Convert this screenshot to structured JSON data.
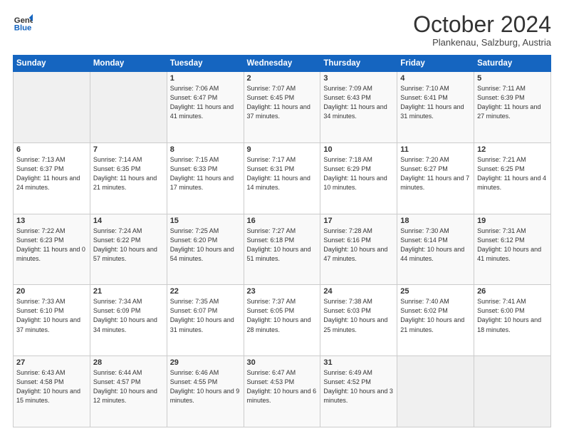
{
  "header": {
    "logo_line1": "General",
    "logo_line2": "Blue",
    "month_title": "October 2024",
    "subtitle": "Plankenau, Salzburg, Austria"
  },
  "days_of_week": [
    "Sunday",
    "Monday",
    "Tuesday",
    "Wednesday",
    "Thursday",
    "Friday",
    "Saturday"
  ],
  "weeks": [
    [
      {
        "day": "",
        "sunrise": "",
        "sunset": "",
        "daylight": ""
      },
      {
        "day": "",
        "sunrise": "",
        "sunset": "",
        "daylight": ""
      },
      {
        "day": "1",
        "sunrise": "Sunrise: 7:06 AM",
        "sunset": "Sunset: 6:47 PM",
        "daylight": "Daylight: 11 hours and 41 minutes."
      },
      {
        "day": "2",
        "sunrise": "Sunrise: 7:07 AM",
        "sunset": "Sunset: 6:45 PM",
        "daylight": "Daylight: 11 hours and 37 minutes."
      },
      {
        "day": "3",
        "sunrise": "Sunrise: 7:09 AM",
        "sunset": "Sunset: 6:43 PM",
        "daylight": "Daylight: 11 hours and 34 minutes."
      },
      {
        "day": "4",
        "sunrise": "Sunrise: 7:10 AM",
        "sunset": "Sunset: 6:41 PM",
        "daylight": "Daylight: 11 hours and 31 minutes."
      },
      {
        "day": "5",
        "sunrise": "Sunrise: 7:11 AM",
        "sunset": "Sunset: 6:39 PM",
        "daylight": "Daylight: 11 hours and 27 minutes."
      }
    ],
    [
      {
        "day": "6",
        "sunrise": "Sunrise: 7:13 AM",
        "sunset": "Sunset: 6:37 PM",
        "daylight": "Daylight: 11 hours and 24 minutes."
      },
      {
        "day": "7",
        "sunrise": "Sunrise: 7:14 AM",
        "sunset": "Sunset: 6:35 PM",
        "daylight": "Daylight: 11 hours and 21 minutes."
      },
      {
        "day": "8",
        "sunrise": "Sunrise: 7:15 AM",
        "sunset": "Sunset: 6:33 PM",
        "daylight": "Daylight: 11 hours and 17 minutes."
      },
      {
        "day": "9",
        "sunrise": "Sunrise: 7:17 AM",
        "sunset": "Sunset: 6:31 PM",
        "daylight": "Daylight: 11 hours and 14 minutes."
      },
      {
        "day": "10",
        "sunrise": "Sunrise: 7:18 AM",
        "sunset": "Sunset: 6:29 PM",
        "daylight": "Daylight: 11 hours and 10 minutes."
      },
      {
        "day": "11",
        "sunrise": "Sunrise: 7:20 AM",
        "sunset": "Sunset: 6:27 PM",
        "daylight": "Daylight: 11 hours and 7 minutes."
      },
      {
        "day": "12",
        "sunrise": "Sunrise: 7:21 AM",
        "sunset": "Sunset: 6:25 PM",
        "daylight": "Daylight: 11 hours and 4 minutes."
      }
    ],
    [
      {
        "day": "13",
        "sunrise": "Sunrise: 7:22 AM",
        "sunset": "Sunset: 6:23 PM",
        "daylight": "Daylight: 11 hours and 0 minutes."
      },
      {
        "day": "14",
        "sunrise": "Sunrise: 7:24 AM",
        "sunset": "Sunset: 6:22 PM",
        "daylight": "Daylight: 10 hours and 57 minutes."
      },
      {
        "day": "15",
        "sunrise": "Sunrise: 7:25 AM",
        "sunset": "Sunset: 6:20 PM",
        "daylight": "Daylight: 10 hours and 54 minutes."
      },
      {
        "day": "16",
        "sunrise": "Sunrise: 7:27 AM",
        "sunset": "Sunset: 6:18 PM",
        "daylight": "Daylight: 10 hours and 51 minutes."
      },
      {
        "day": "17",
        "sunrise": "Sunrise: 7:28 AM",
        "sunset": "Sunset: 6:16 PM",
        "daylight": "Daylight: 10 hours and 47 minutes."
      },
      {
        "day": "18",
        "sunrise": "Sunrise: 7:30 AM",
        "sunset": "Sunset: 6:14 PM",
        "daylight": "Daylight: 10 hours and 44 minutes."
      },
      {
        "day": "19",
        "sunrise": "Sunrise: 7:31 AM",
        "sunset": "Sunset: 6:12 PM",
        "daylight": "Daylight: 10 hours and 41 minutes."
      }
    ],
    [
      {
        "day": "20",
        "sunrise": "Sunrise: 7:33 AM",
        "sunset": "Sunset: 6:10 PM",
        "daylight": "Daylight: 10 hours and 37 minutes."
      },
      {
        "day": "21",
        "sunrise": "Sunrise: 7:34 AM",
        "sunset": "Sunset: 6:09 PM",
        "daylight": "Daylight: 10 hours and 34 minutes."
      },
      {
        "day": "22",
        "sunrise": "Sunrise: 7:35 AM",
        "sunset": "Sunset: 6:07 PM",
        "daylight": "Daylight: 10 hours and 31 minutes."
      },
      {
        "day": "23",
        "sunrise": "Sunrise: 7:37 AM",
        "sunset": "Sunset: 6:05 PM",
        "daylight": "Daylight: 10 hours and 28 minutes."
      },
      {
        "day": "24",
        "sunrise": "Sunrise: 7:38 AM",
        "sunset": "Sunset: 6:03 PM",
        "daylight": "Daylight: 10 hours and 25 minutes."
      },
      {
        "day": "25",
        "sunrise": "Sunrise: 7:40 AM",
        "sunset": "Sunset: 6:02 PM",
        "daylight": "Daylight: 10 hours and 21 minutes."
      },
      {
        "day": "26",
        "sunrise": "Sunrise: 7:41 AM",
        "sunset": "Sunset: 6:00 PM",
        "daylight": "Daylight: 10 hours and 18 minutes."
      }
    ],
    [
      {
        "day": "27",
        "sunrise": "Sunrise: 6:43 AM",
        "sunset": "Sunset: 4:58 PM",
        "daylight": "Daylight: 10 hours and 15 minutes."
      },
      {
        "day": "28",
        "sunrise": "Sunrise: 6:44 AM",
        "sunset": "Sunset: 4:57 PM",
        "daylight": "Daylight: 10 hours and 12 minutes."
      },
      {
        "day": "29",
        "sunrise": "Sunrise: 6:46 AM",
        "sunset": "Sunset: 4:55 PM",
        "daylight": "Daylight: 10 hours and 9 minutes."
      },
      {
        "day": "30",
        "sunrise": "Sunrise: 6:47 AM",
        "sunset": "Sunset: 4:53 PM",
        "daylight": "Daylight: 10 hours and 6 minutes."
      },
      {
        "day": "31",
        "sunrise": "Sunrise: 6:49 AM",
        "sunset": "Sunset: 4:52 PM",
        "daylight": "Daylight: 10 hours and 3 minutes."
      },
      {
        "day": "",
        "sunrise": "",
        "sunset": "",
        "daylight": ""
      },
      {
        "day": "",
        "sunrise": "",
        "sunset": "",
        "daylight": ""
      }
    ]
  ]
}
